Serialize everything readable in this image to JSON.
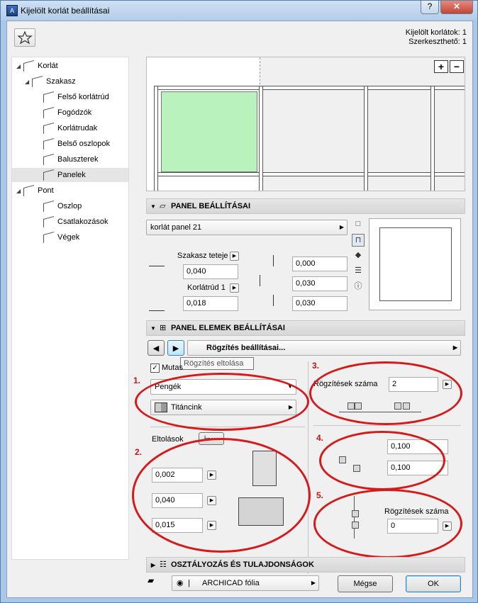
{
  "window": {
    "title": "Kijelölt korlát beállításai",
    "help": "?",
    "minimize": "–",
    "maximize": "□",
    "close": "✕"
  },
  "info": {
    "selected": "Kijelölt korlátok: 1",
    "editable": "Szerkeszthető: 1"
  },
  "tree": [
    {
      "label": "Korlát",
      "icon": "railing-icon"
    },
    {
      "label": "Szakasz",
      "icon": "segment-icon"
    },
    {
      "label": "Felső korlátrúd",
      "icon": "top-rail-icon"
    },
    {
      "label": "Fogódzók",
      "icon": "handrail-icon"
    },
    {
      "label": "Korlátrudak",
      "icon": "rails-icon"
    },
    {
      "label": "Belső oszlopok",
      "icon": "inner-posts-icon"
    },
    {
      "label": "Baluszterek",
      "icon": "balusters-icon"
    },
    {
      "label": "Panelek",
      "icon": "panel-icon"
    },
    {
      "label": "Pont",
      "icon": "node-icon"
    },
    {
      "label": "Oszlop",
      "icon": "post-icon"
    },
    {
      "label": "Csatlakozások",
      "icon": "connections-icon"
    },
    {
      "label": "Végek",
      "icon": "ends-icon"
    }
  ],
  "preview": {
    "zoom_in": "+",
    "zoom_out": "−"
  },
  "panel_settings": {
    "header": "PANEL BEÁLLÍTÁSAI",
    "panel_type": "korlát panel 21",
    "segment_top_label": "Szakasz teteje",
    "segment_top_value": "0,040",
    "rail_label": "Korlátrúd 1",
    "rail_value": "0,018",
    "offset_value": "0,000",
    "gap_left_value": "0,030",
    "gap_right_value": "0,030"
  },
  "panel_elements": {
    "header": "PANEL ELEMEK BEÁLLÍTÁSAI",
    "fixing_menu": "Rögzítés beállításai...",
    "tooltip": "Rögzítés eltolása",
    "show_label": "Mutas",
    "blade_type": "Pengék",
    "material": "Titáncink",
    "offsets_label": "Eltolások",
    "off1": "0,002",
    "off2": "0,040",
    "off3": "0,015",
    "fix_count_label": "Rögzítések száma",
    "fix_count_value": "2",
    "v1": "0,100",
    "v2": "0,100",
    "fix_count2_label": "Rögzítések száma",
    "fix_count2_value": "0"
  },
  "annotations": [
    "1.",
    "2.",
    "3.",
    "4.",
    "5."
  ],
  "classification": {
    "header": "OSZTÁLYOZÁS ÉS TULAJDONSÁGOK"
  },
  "footer": {
    "layer": "ARCHICAD fólia",
    "cancel": "Mégse",
    "ok": "OK"
  },
  "colors": {
    "panel_fill": "#b9f2bd",
    "annotation": "#d41b1b",
    "titlebar": "#b9d1ec",
    "close": "#c8473d"
  }
}
